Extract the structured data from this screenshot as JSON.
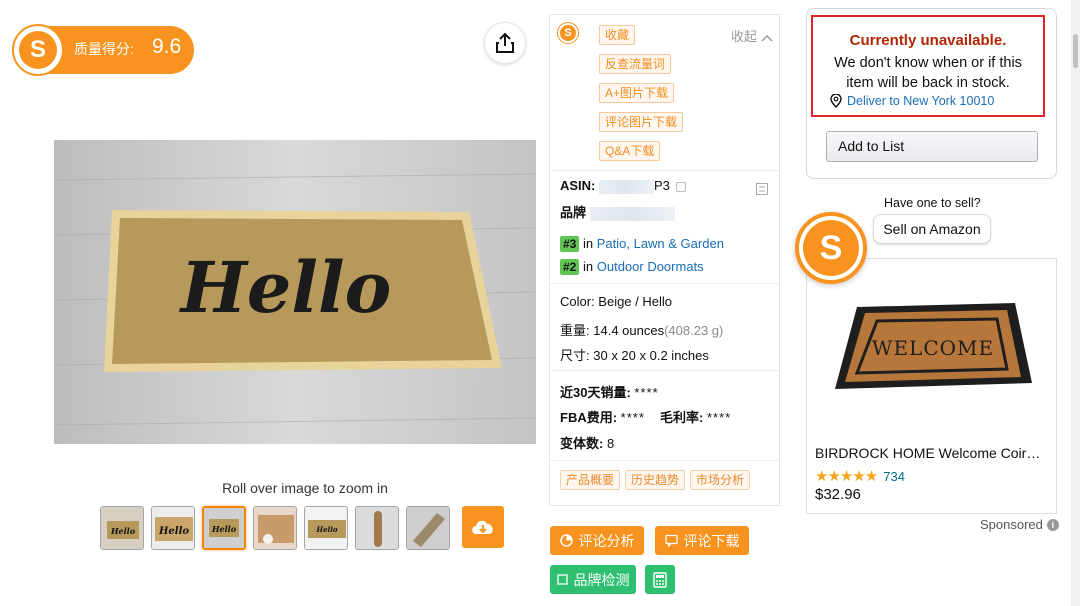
{
  "score_badge": {
    "label": "质量得分:",
    "value": "9.6",
    "logo_letter": "S"
  },
  "gallery": {
    "main_image_text": "Hello",
    "zoom_hint": "Roll over image to zoom in",
    "thumb_texts": [
      "Hello",
      "Hello",
      "Hello",
      "",
      "Hello",
      "",
      ""
    ]
  },
  "panel": {
    "logo_letter": "S",
    "collapse_label": "收起",
    "tag_buttons": [
      "收藏",
      "反查流量词",
      "A+图片下载",
      "评论图片下载",
      "Q&A下载"
    ],
    "asin_label": "ASIN:",
    "asin_visible_tail": "P3",
    "brand_label": "品牌",
    "ranks": [
      {
        "badge": "#3",
        "in": "in",
        "category": "Patio, Lawn & Garden"
      },
      {
        "badge": "#2",
        "in": "in",
        "category": "Outdoor Doormats"
      }
    ],
    "color_line": "Color: Beige / Hello",
    "weight_label": "重量:",
    "weight_value": "14.4 ounces",
    "weight_grams": "(408.23 g)",
    "size_label": "尺寸:",
    "size_value": "30 x 20 x 0.2 inches",
    "sales_label": "近30天销量:",
    "sales_value": "****",
    "fba_label": "FBA费用:",
    "fba_value": "****",
    "margin_label": "毛利率:",
    "margin_value": "****",
    "variants_label": "变体数:",
    "variants_value": "8",
    "tabs": [
      "产品概要",
      "历史趋势",
      "市场分析"
    ],
    "actions": {
      "review_analysis": "评论分析",
      "review_download": "评论下载",
      "brand_check": "品牌检测"
    }
  },
  "buybox": {
    "unavailable_title": "Currently unavailable.",
    "unavailable_line1": "We don't know when or if this",
    "unavailable_line2": "item will be back in stock.",
    "deliver_to": "Deliver to New York 10010",
    "add_to_list": "Add to List"
  },
  "sell": {
    "have_one": "Have one to sell?",
    "button": "Sell on Amazon"
  },
  "ad": {
    "image_text": "WELCOME",
    "title": "BIRDROCK HOME Welcome Coir…",
    "stars": "★★★★★",
    "rating_count": "734",
    "rating": 4.5,
    "price": "$32.96",
    "sponsored": "Sponsored",
    "info_glyph": "i"
  },
  "colors": {
    "brand_orange": "#f7931e",
    "green": "#2fbf71",
    "alert_red": "#e0232a",
    "link_blue": "#1a6db5"
  },
  "icons": [
    "share-icon",
    "location-pin-icon",
    "cloud-download-icon",
    "copy-icon",
    "settings-icon",
    "chevron-up-icon",
    "pie-chart-icon",
    "comment-icon",
    "square-icon",
    "calculator-icon",
    "info-icon"
  ]
}
